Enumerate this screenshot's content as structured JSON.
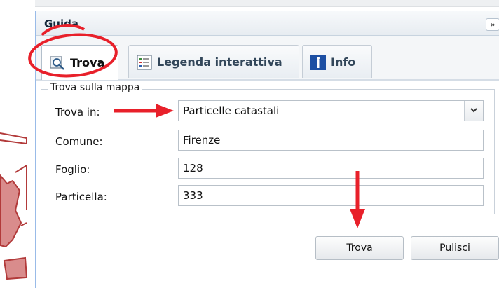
{
  "panel": {
    "title": "Guida",
    "collapse_icon": "double-chevron-right-icon",
    "collapse_glyph": "»"
  },
  "tabs": [
    {
      "label": "Trova",
      "icon": "search-map-icon",
      "active": true
    },
    {
      "label": "Legenda interattiva",
      "icon": "legend-list-icon",
      "active": false
    },
    {
      "label": "Info",
      "icon": "info-icon",
      "active": false
    }
  ],
  "find": {
    "legend": "Trova sulla mappa",
    "rows": [
      {
        "label": "Trova in:",
        "value": "Particelle catastali",
        "type": "select"
      },
      {
        "label": "Comune:",
        "value": "Firenze",
        "type": "text"
      },
      {
        "label": "Foglio:",
        "value": "128",
        "type": "text"
      },
      {
        "label": "Particella:",
        "value": "333",
        "type": "text"
      }
    ]
  },
  "buttons": {
    "find": "Trova",
    "clear": "Pulisci"
  },
  "colors": {
    "annotation_red": "#e8202a",
    "parcel_fill": "#d98c8c",
    "parcel_border": "#b23a3a",
    "panel_border": "#99bbe8"
  }
}
